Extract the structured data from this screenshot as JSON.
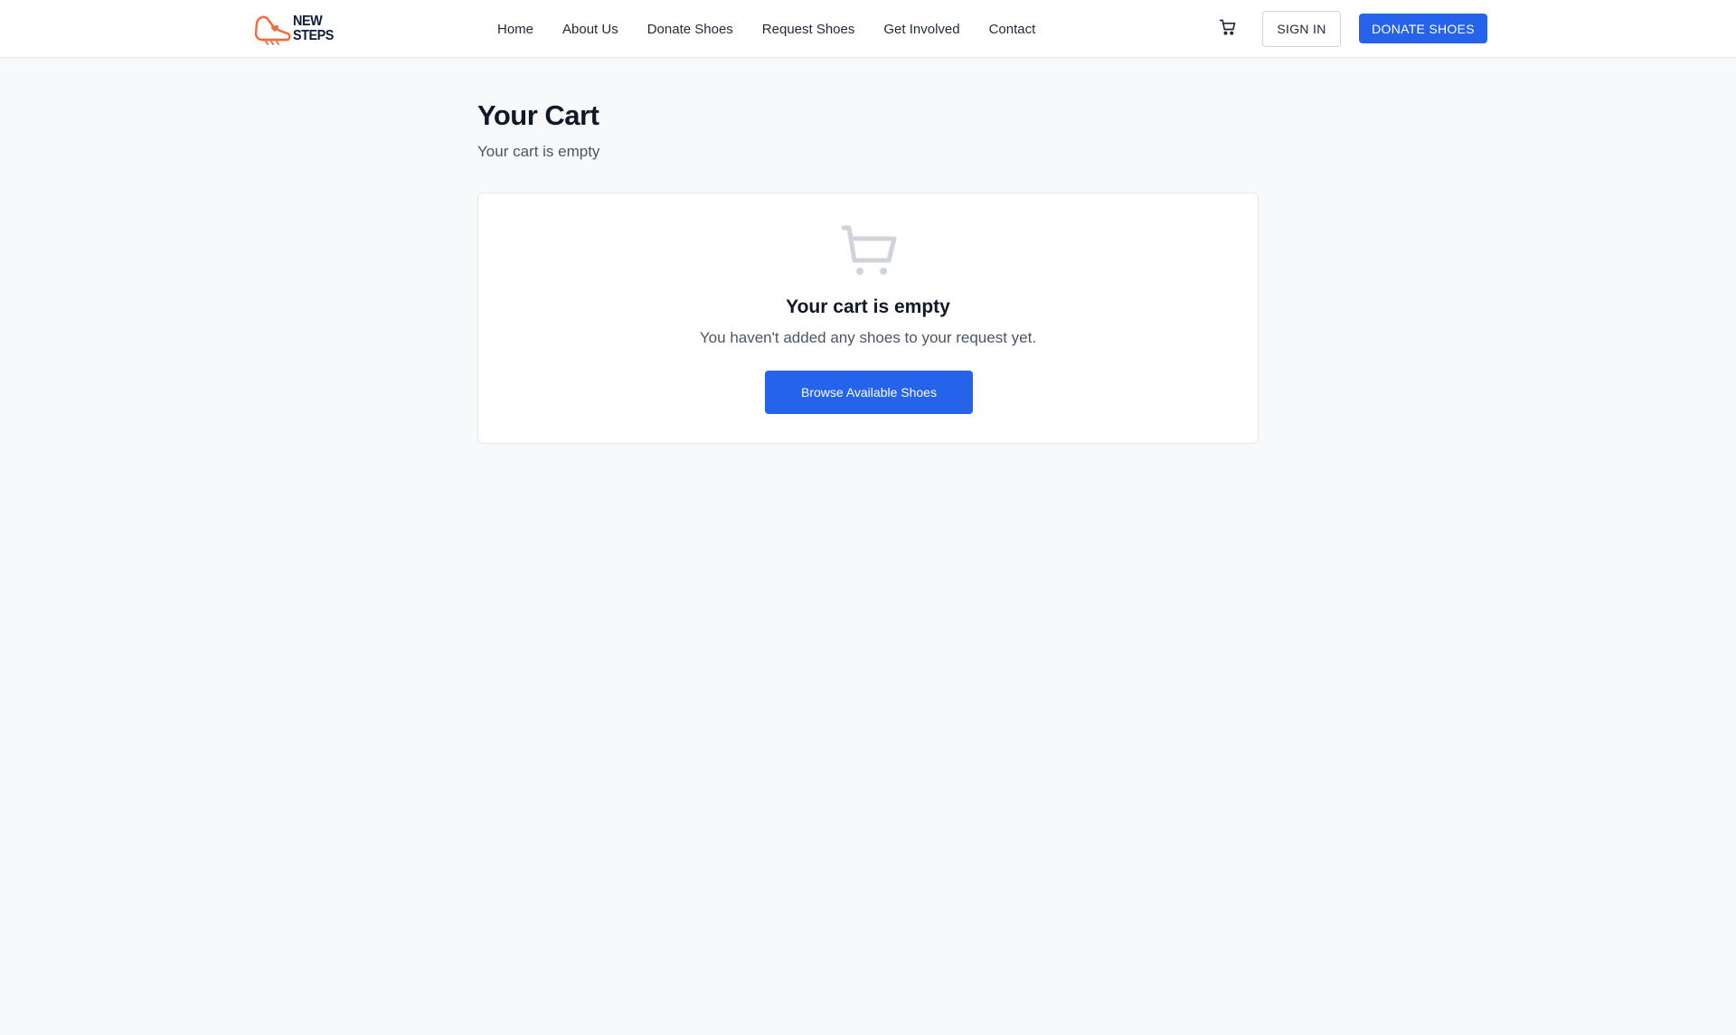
{
  "brand": {
    "name_line1": "NEW",
    "name_line2": "STEPS",
    "logo_icon": "shoe-heart-icon",
    "accent_color": "#f26b3a"
  },
  "nav": {
    "items": [
      {
        "label": "Home"
      },
      {
        "label": "About Us"
      },
      {
        "label": "Donate Shoes"
      },
      {
        "label": "Request Shoes"
      },
      {
        "label": "Get Involved"
      },
      {
        "label": "Contact"
      }
    ],
    "cart_icon": "shopping-cart-icon",
    "signin_label": "SIGN IN",
    "donate_label": "DONATE SHOES"
  },
  "page": {
    "title": "Your Cart",
    "subtitle": "Your cart is empty"
  },
  "empty_state": {
    "icon": "shopping-cart-icon",
    "title": "Your cart is empty",
    "message": "You haven't added any shoes to your request yet.",
    "button_label": "Browse Available Shoes"
  },
  "colors": {
    "primary": "#2563eb",
    "background": "#f8f9fb",
    "text_dark": "#111827",
    "text_muted": "#4b5563",
    "icon_muted": "#d1d5db"
  }
}
